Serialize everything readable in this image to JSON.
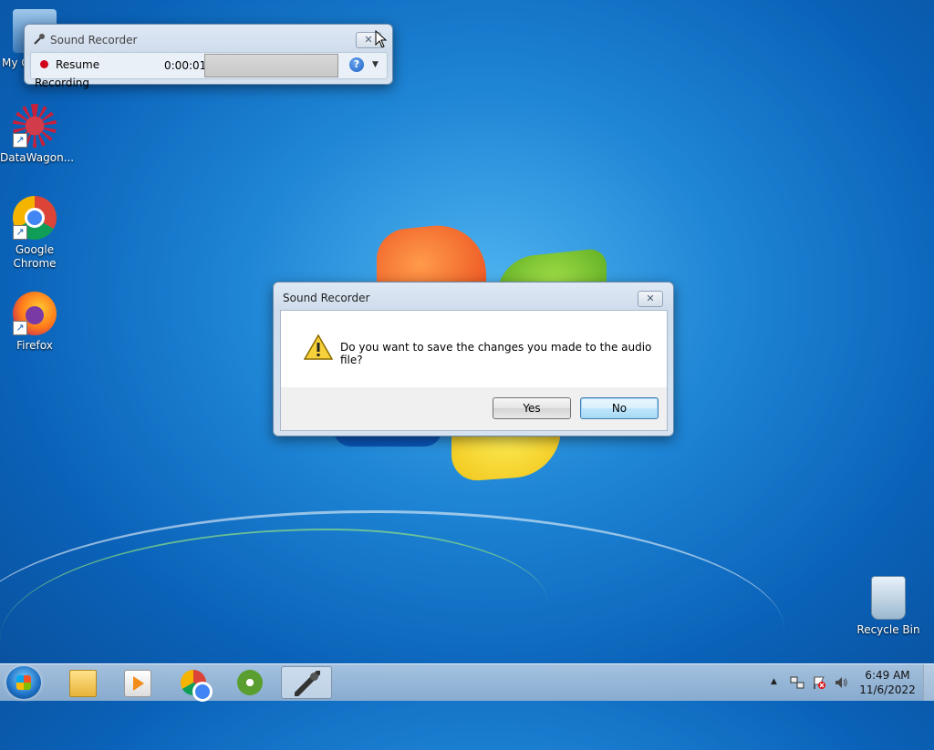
{
  "desktop": {
    "icons": [
      {
        "label": "My C"
      },
      {
        "label": "DataWagon..."
      },
      {
        "label": "Google Chrome"
      },
      {
        "label": "Firefox"
      },
      {
        "label": "Recycle Bin"
      }
    ]
  },
  "recorder": {
    "title": "Sound Recorder",
    "resume_label": "Resume Recording",
    "timer": "0:00:01",
    "help_glyph": "?",
    "dropdown_glyph": "▼",
    "close_glyph": "✕"
  },
  "dialog": {
    "title": "Sound Recorder",
    "message": "Do you want to save the changes you made to the audio file?",
    "yes_label": "Yes",
    "no_label": "No",
    "close_glyph": "✕",
    "icon": "warning-icon"
  },
  "taskbar": {
    "items": [
      "start-button",
      "file-explorer",
      "windows-media-player",
      "google-chrome",
      "windows-icon",
      "sound-recorder"
    ],
    "tray_arrow": "▲",
    "time": "6:49 AM",
    "date": "11/6/2022"
  },
  "colors": {
    "record_dot": "#d0021b",
    "focus_border": "#3c7fb1"
  }
}
